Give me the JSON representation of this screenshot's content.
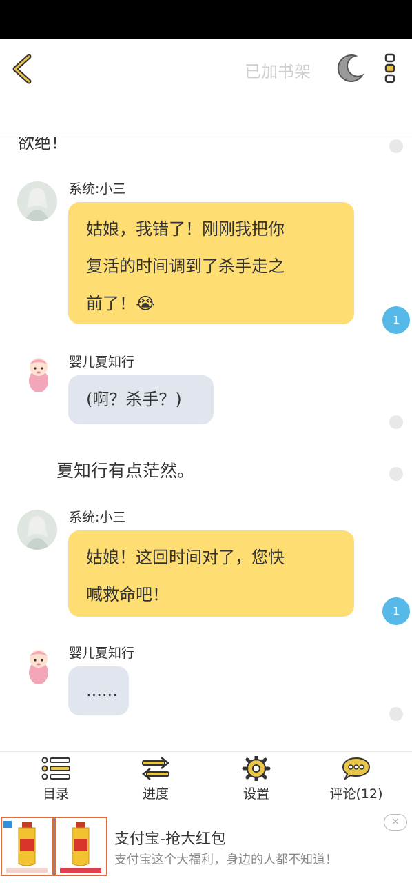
{
  "header": {
    "shelf_label": "已加书架"
  },
  "chat": {
    "cut_text": "欲绝！",
    "messages": [
      {
        "name": "系统:小三",
        "text_lines": [
          "姑娘，我错了！刚刚我把你",
          "复活的时间调到了杀手走之",
          "前了！😭"
        ],
        "badge": "1"
      },
      {
        "name": "婴儿夏知行",
        "text": "(啊？杀手？)"
      },
      {
        "narration": "夏知行有点茫然。"
      },
      {
        "name": "系统:小三",
        "text_lines": [
          "姑娘！这回时间对了，您快",
          "喊救命吧！"
        ],
        "badge": "1"
      },
      {
        "name": "婴儿夏知行",
        "text": "......"
      }
    ]
  },
  "bottom_nav": {
    "catalog": "目录",
    "progress": "进度",
    "settings": "设置",
    "comments": "评论(12)"
  },
  "ad": {
    "title": "支付宝-抢大红包",
    "subtitle": "支付宝这个大福利，身边的人都不知道！",
    "close": "×"
  },
  "colors": {
    "system_bubble": "#fedd73",
    "user_bubble": "#e1e6ee",
    "badge": "#56b9e8",
    "accent_icon": "#e9c54a"
  }
}
